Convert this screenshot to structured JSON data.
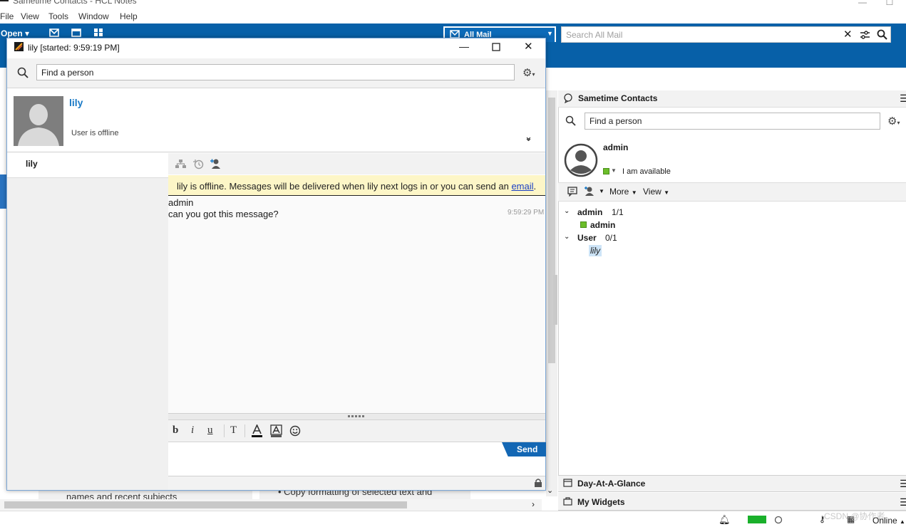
{
  "app": {
    "title": "Sametime Contacts - HCL Notes",
    "menu": [
      "File",
      "View",
      "Tools",
      "Window",
      "Help"
    ],
    "open_label": "Open",
    "mail_scope": "All Mail",
    "search_placeholder": "Search All Mail"
  },
  "background_text": {
    "left_snippet": "names and recent subjects",
    "right_snippet": "Copy formatting of selected text and"
  },
  "chat": {
    "window_title": "lily [started: 9:59:19 PM]",
    "find_placeholder": "Find a person",
    "contact_name": "lily",
    "contact_status": "User is offline",
    "participants": [
      "lily"
    ],
    "offline_notice_prefix": "lily is offline. Messages will be delivered when lily next logs in or you can send an ",
    "offline_notice_link": "email",
    "offline_notice_suffix": ".",
    "messages": [
      {
        "sender": "admin",
        "text": "can you got this message?",
        "time": "9:59:29 PM"
      }
    ],
    "format_buttons": {
      "bold": "b",
      "italic": "i",
      "underline": "u",
      "font": "T"
    },
    "send_label": "Send"
  },
  "sametime": {
    "title": "Sametime Contacts",
    "find_placeholder": "Find a person",
    "me_name": "admin",
    "me_status": "I am available",
    "toolbar": {
      "more": "More",
      "view": "View"
    },
    "groups": [
      {
        "name": "admin",
        "count": "1/1",
        "members": [
          {
            "name": "admin",
            "online": true
          }
        ]
      },
      {
        "name": "User",
        "count": "0/1",
        "members": [
          {
            "name": "lily",
            "online": false
          }
        ]
      }
    ],
    "day_at_a_glance": "Day-At-A-Glance",
    "my_widgets": "My Widgets"
  },
  "statusbar": {
    "online_label": "Online",
    "watermark": "CSDN @协作者"
  },
  "colors": {
    "brand_blue": "#0760a8",
    "link_blue": "#1a7ac6",
    "available_green": "#6cbe2a",
    "offline_banner": "#fdf6c7"
  }
}
